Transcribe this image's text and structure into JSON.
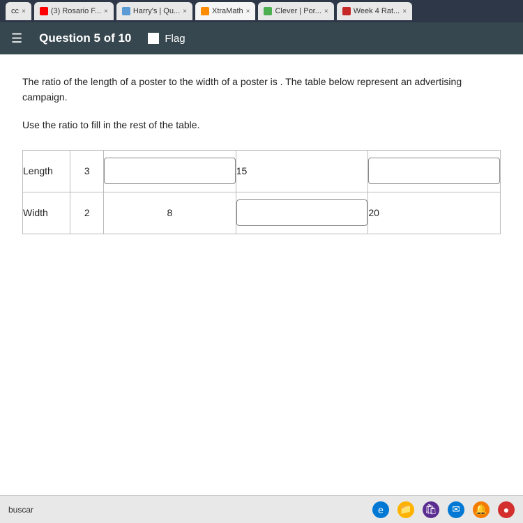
{
  "browser": {
    "tabs": [
      {
        "id": "cc",
        "label": "cc",
        "icon_type": "default",
        "active": false
      },
      {
        "id": "rosario",
        "label": "(3) Rosario F...",
        "icon_type": "youtube",
        "active": false
      },
      {
        "id": "harry",
        "label": "Harry's | Qu...",
        "icon_type": "harry",
        "active": false
      },
      {
        "id": "xtramath",
        "label": "XtraMath",
        "icon_type": "xtramath",
        "active": true
      },
      {
        "id": "clever",
        "label": "Clever | Por...",
        "icon_type": "clever",
        "active": false
      },
      {
        "id": "week",
        "label": "Week 4 Rat...",
        "icon_type": "week",
        "active": false
      }
    ]
  },
  "header": {
    "menu_icon": "☰",
    "question_title": "Question 5 of 10",
    "flag_label": "Flag"
  },
  "question": {
    "text": "The ratio of the length of a poster to the width of a poster is . The table below represent an advertising campaign.",
    "instruction": "Use the ratio to fill in the rest of the table."
  },
  "table": {
    "rows": [
      {
        "label": "Length",
        "cells": [
          {
            "type": "value",
            "value": "3"
          },
          {
            "type": "input",
            "placeholder": ""
          },
          {
            "type": "value",
            "value": "15"
          },
          {
            "type": "input",
            "placeholder": ""
          }
        ]
      },
      {
        "label": "Width",
        "cells": [
          {
            "type": "value",
            "value": "2"
          },
          {
            "type": "value",
            "value": "8"
          },
          {
            "type": "input",
            "placeholder": ""
          },
          {
            "type": "value",
            "value": "20"
          }
        ]
      }
    ]
  },
  "taskbar": {
    "search_placeholder": "buscar",
    "icons": [
      {
        "name": "edge-icon",
        "symbol": "e",
        "color_class": "edge"
      },
      {
        "name": "folder-icon",
        "symbol": "📁",
        "color_class": "folder"
      },
      {
        "name": "bag-icon",
        "symbol": "🛍",
        "color_class": "bag"
      },
      {
        "name": "mail-icon",
        "symbol": "✉",
        "color_class": "mail"
      },
      {
        "name": "alert-icon",
        "symbol": "🔔",
        "color_class": "alert"
      },
      {
        "name": "red-circle-icon",
        "symbol": "●",
        "color_class": "red-circle"
      }
    ]
  }
}
